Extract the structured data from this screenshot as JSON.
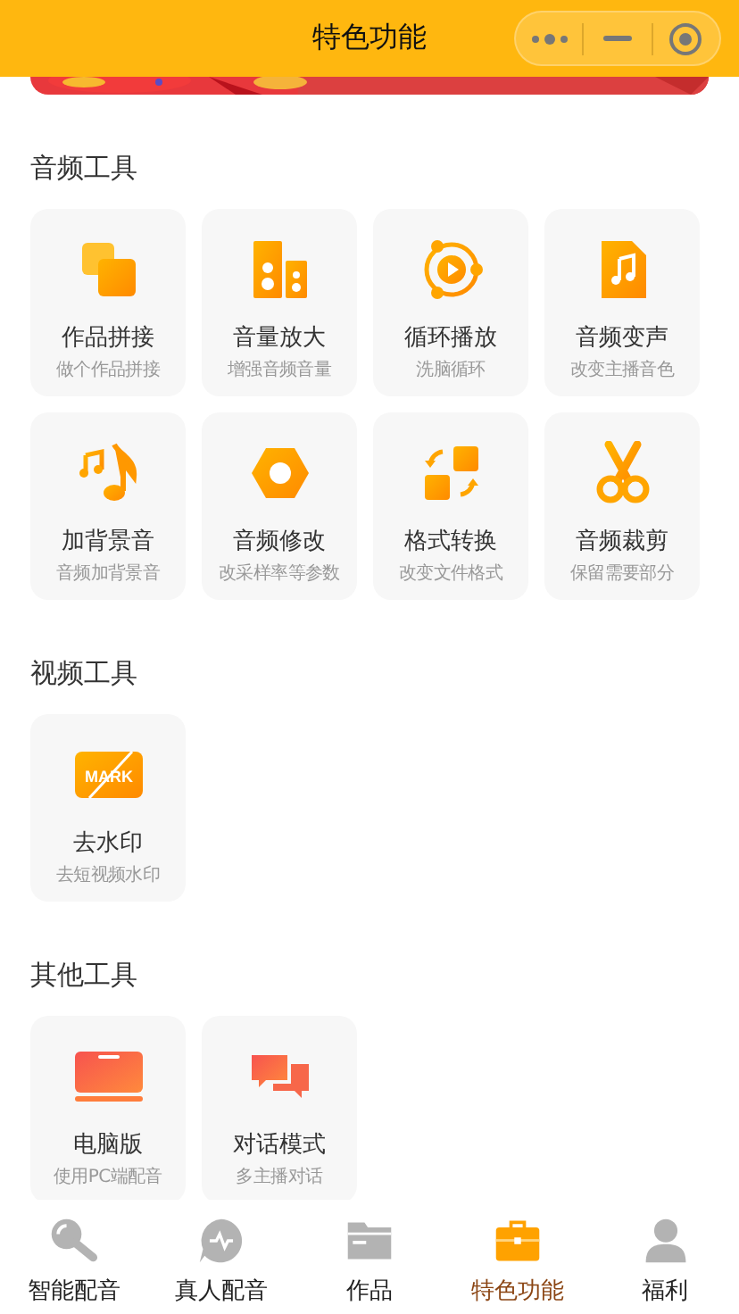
{
  "header": {
    "title": "特色功能"
  },
  "sections": [
    {
      "title": "音频工具",
      "tools": [
        {
          "name": "作品拼接",
          "desc": "做个作品拼接"
        },
        {
          "name": "音量放大",
          "desc": "增强音频音量"
        },
        {
          "name": "循环播放",
          "desc": "洗脑循环"
        },
        {
          "name": "音频变声",
          "desc": "改变主播音色"
        },
        {
          "name": "加背景音",
          "desc": "音频加背景音"
        },
        {
          "name": "音频修改",
          "desc": "改采样率等参数"
        },
        {
          "name": "格式转换",
          "desc": "改变文件格式"
        },
        {
          "name": "音频裁剪",
          "desc": "保留需要部分"
        }
      ]
    },
    {
      "title": "视频工具",
      "tools": [
        {
          "name": "去水印",
          "desc": "去短视频水印",
          "icon_text": "MARK"
        }
      ]
    },
    {
      "title": "其他工具",
      "tools": [
        {
          "name": "电脑版",
          "desc": "使用PC端配音"
        },
        {
          "name": "对话模式",
          "desc": "多主播对话"
        }
      ]
    }
  ],
  "tab_bar": [
    {
      "label": "智能配音",
      "selected": false
    },
    {
      "label": "真人配音",
      "selected": false
    },
    {
      "label": "作品",
      "selected": false
    },
    {
      "label": "特色功能",
      "selected": true
    },
    {
      "label": "福利",
      "selected": false
    }
  ]
}
